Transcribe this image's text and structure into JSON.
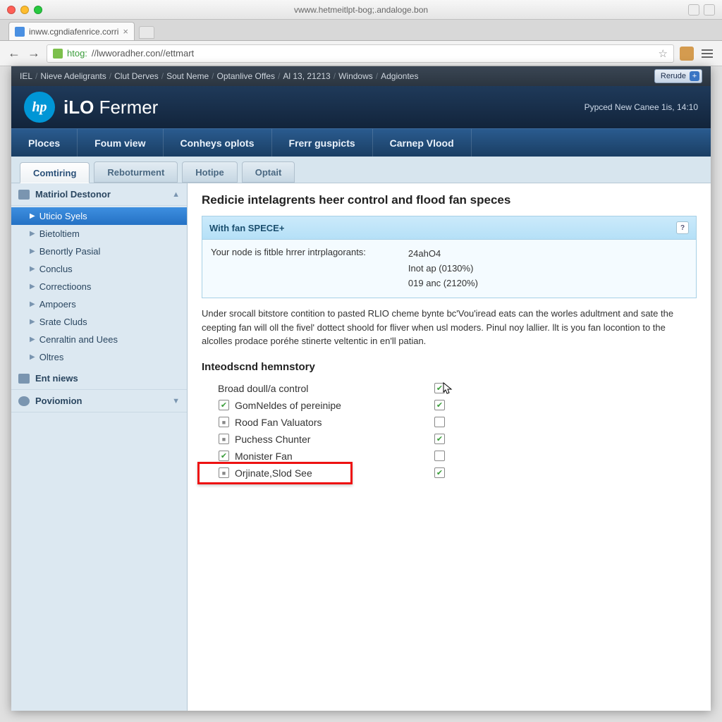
{
  "os": {
    "title": "vwww.hetmeitlpt-bog;.andaloge.bon"
  },
  "tab": {
    "title": "inww.cgndiafenrice.corri"
  },
  "url": {
    "proto": "htog:",
    "path": "//lwworadher.con//ettmart"
  },
  "topnav": {
    "items": [
      "IEL",
      "Nieve Adeligrants",
      "Clut Derves",
      "Sout Neme",
      "Optanlive Offes",
      "Al 13, 21213",
      "Windows",
      "Adgiontes"
    ],
    "selector": "Rerude"
  },
  "brand": {
    "logo": "hp",
    "name_prefix": "iLO ",
    "name_rest": "Fermer",
    "meta": "Pypced New Canee 1is, 14:10"
  },
  "mainnav": [
    "Ploces",
    "Foum view",
    "Conheys oplots",
    "Frerr guspicts",
    "Carnep Vlood"
  ],
  "subtabs": [
    "Comtiring",
    "Reboturment",
    "Hotipe",
    "Optait"
  ],
  "sidebar": {
    "group1": {
      "label": "Matiriol Destonor",
      "items": [
        "Uticio Syels",
        "Bietoltiem",
        "Benortly Pasial",
        "Conclus",
        "Correctioons",
        "Ampoers",
        "Srate Cluds",
        "Cenraltin and Uees",
        "Oltres"
      ],
      "selected": 0
    },
    "group2": {
      "label": "Ent niews"
    },
    "group3": {
      "label": "Poviomion"
    }
  },
  "page": {
    "heading": "Redicie intelagrents heer control and flood fan speces",
    "box": {
      "title": "With fan SPECE+",
      "label": "Your node is fitble hrrer intrplagorants:",
      "v0": "24ahO4",
      "v1": "Inot ap   (0130%)",
      "v2": "019 anc (2120%)"
    },
    "para": "Under srocall bitstore contition to pasted RLIO cheme bynte bc'Vou'iread eats can the worles adultment and sate the ceepting fan will oll the fivel' dottect shoold for fliver when usl moders. Pinul noy lallier. llt is you fan locontion to the alcolles prodace poréhe stinerte veltentic in en'll patian.",
    "sub": "Inteodscnd hemnstory",
    "opts": [
      {
        "label": "Broad doull/a control",
        "lcb": "none",
        "rcb": "chk",
        "child": false
      },
      {
        "label": "GomNeldes of pereinipe",
        "lcb": "chk",
        "rcb": "chk",
        "child": true
      },
      {
        "label": "Rood Fan Valuators",
        "lcb": "semi",
        "rcb": "none",
        "child": true
      },
      {
        "label": "Puchess Chunter",
        "lcb": "semi",
        "rcb": "chk",
        "child": true
      },
      {
        "label": "Monister Fan",
        "lcb": "chk",
        "rcb": "none",
        "child": true
      },
      {
        "label": "Orjinate,Slod See",
        "lcb": "semi",
        "rcb": "chk",
        "child": true
      }
    ],
    "highlight_index": 5
  }
}
